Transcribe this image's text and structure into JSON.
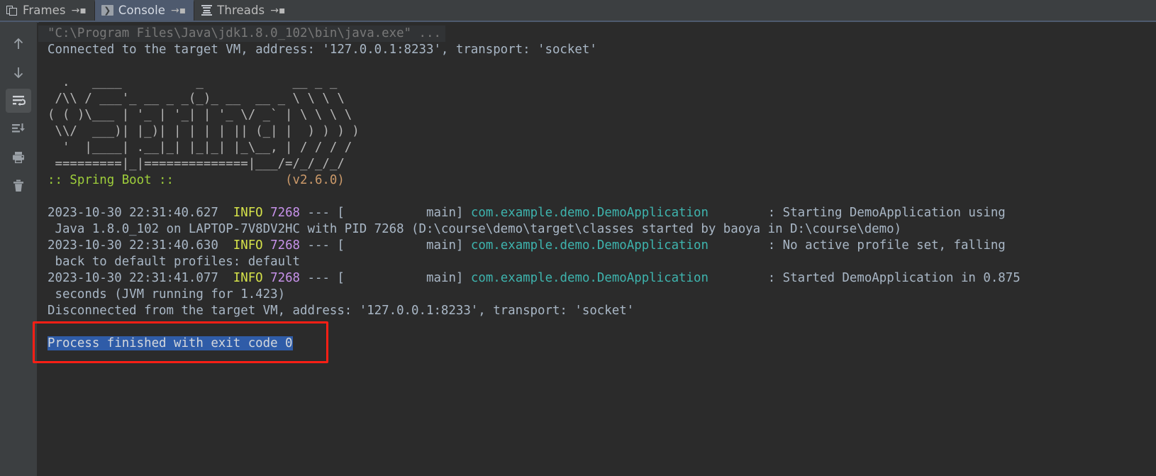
{
  "window": {
    "background": "#2b2b2b",
    "chrome_background": "#3c3f41",
    "accent_selected_tab": "#4e5a6e",
    "annotation_color": "#fc1f15",
    "selection_color": "#2f5ca8"
  },
  "tabs": [
    {
      "id": "frames",
      "label": "Frames",
      "icon": "frames-icon",
      "pin": "→▪",
      "selected": false
    },
    {
      "id": "console",
      "label": "Console",
      "icon": "console-icon",
      "pin": "→▪",
      "selected": true
    },
    {
      "id": "threads",
      "label": "Threads",
      "icon": "threads-icon",
      "pin": "→▪",
      "selected": false
    }
  ],
  "toolbar": {
    "items": [
      {
        "id": "up",
        "name": "up-arrow-icon",
        "tooltip": "Up the Stack Trace",
        "active": false
      },
      {
        "id": "down",
        "name": "down-arrow-icon",
        "tooltip": "Down the Stack Trace",
        "active": false
      },
      {
        "id": "softwrap",
        "name": "soft-wrap-icon",
        "tooltip": "Use Soft Wraps",
        "active": true
      },
      {
        "id": "scrollend",
        "name": "scroll-to-end-icon",
        "tooltip": "Scroll to the end",
        "active": false
      },
      {
        "id": "print",
        "name": "print-icon",
        "tooltip": "Print",
        "active": false
      },
      {
        "id": "clear",
        "name": "trash-icon",
        "tooltip": "Clear All",
        "active": false
      }
    ]
  },
  "console": {
    "command_line": "\"C:\\Program Files\\Java\\jdk1.8.0_102\\bin\\java.exe\" ...",
    "connected_line": "Connected to the target VM, address: '127.0.0.1:8233', transport: 'socket'",
    "banner": {
      "ascii": [
        "  .   ____          _            __ _ _",
        " /\\\\ / ___'_ __ _ _(_)_ __  __ _ \\ \\ \\ \\",
        "( ( )\\___ | '_ | '_| | '_ \\/ _` | \\ \\ \\ \\",
        " \\\\/  ___)| |_)| | | | | || (_| |  ) ) ) )",
        "  '  |____| .__|_| |_|_| |_\\__, | / / / /",
        " =========|_|==============|___/=/_/_/_/"
      ],
      "title": ":: Spring Boot ::",
      "version": "(v2.6.0)",
      "title_color": "#9fcf3b",
      "version_color": "#cc9a6a"
    },
    "log_entries": [
      {
        "timestamp": "2023-10-30 22:31:40.627",
        "level": "INFO",
        "pid": "7268",
        "separator": "--- [",
        "thread": "main]",
        "logger": "com.example.demo.DemoApplication",
        "colon": ":",
        "message": "Starting DemoApplication using",
        "wrapped": " Java 1.8.0_102 on LAPTOP-7V8DV2HC with PID 7268 (D:\\course\\demo\\target\\classes started by baoya in D:\\course\\demo)"
      },
      {
        "timestamp": "2023-10-30 22:31:40.630",
        "level": "INFO",
        "pid": "7268",
        "separator": "--- [",
        "thread": "main]",
        "logger": "com.example.demo.DemoApplication",
        "colon": ":",
        "message": "No active profile set, falling",
        "wrapped": " back to default profiles: default"
      },
      {
        "timestamp": "2023-10-30 22:31:41.077",
        "level": "INFO",
        "pid": "7268",
        "separator": "--- [",
        "thread": "main]",
        "logger": "com.example.demo.DemoApplication",
        "colon": ":",
        "message": "Started DemoApplication in 0.875",
        "wrapped": " seconds (JVM running for 1.423)"
      }
    ],
    "disconnected_line": "Disconnected from the target VM, address: '127.0.0.1:8233', transport: 'socket'",
    "exit_line": "Process finished with exit code 0",
    "exit_line_selected": true
  }
}
